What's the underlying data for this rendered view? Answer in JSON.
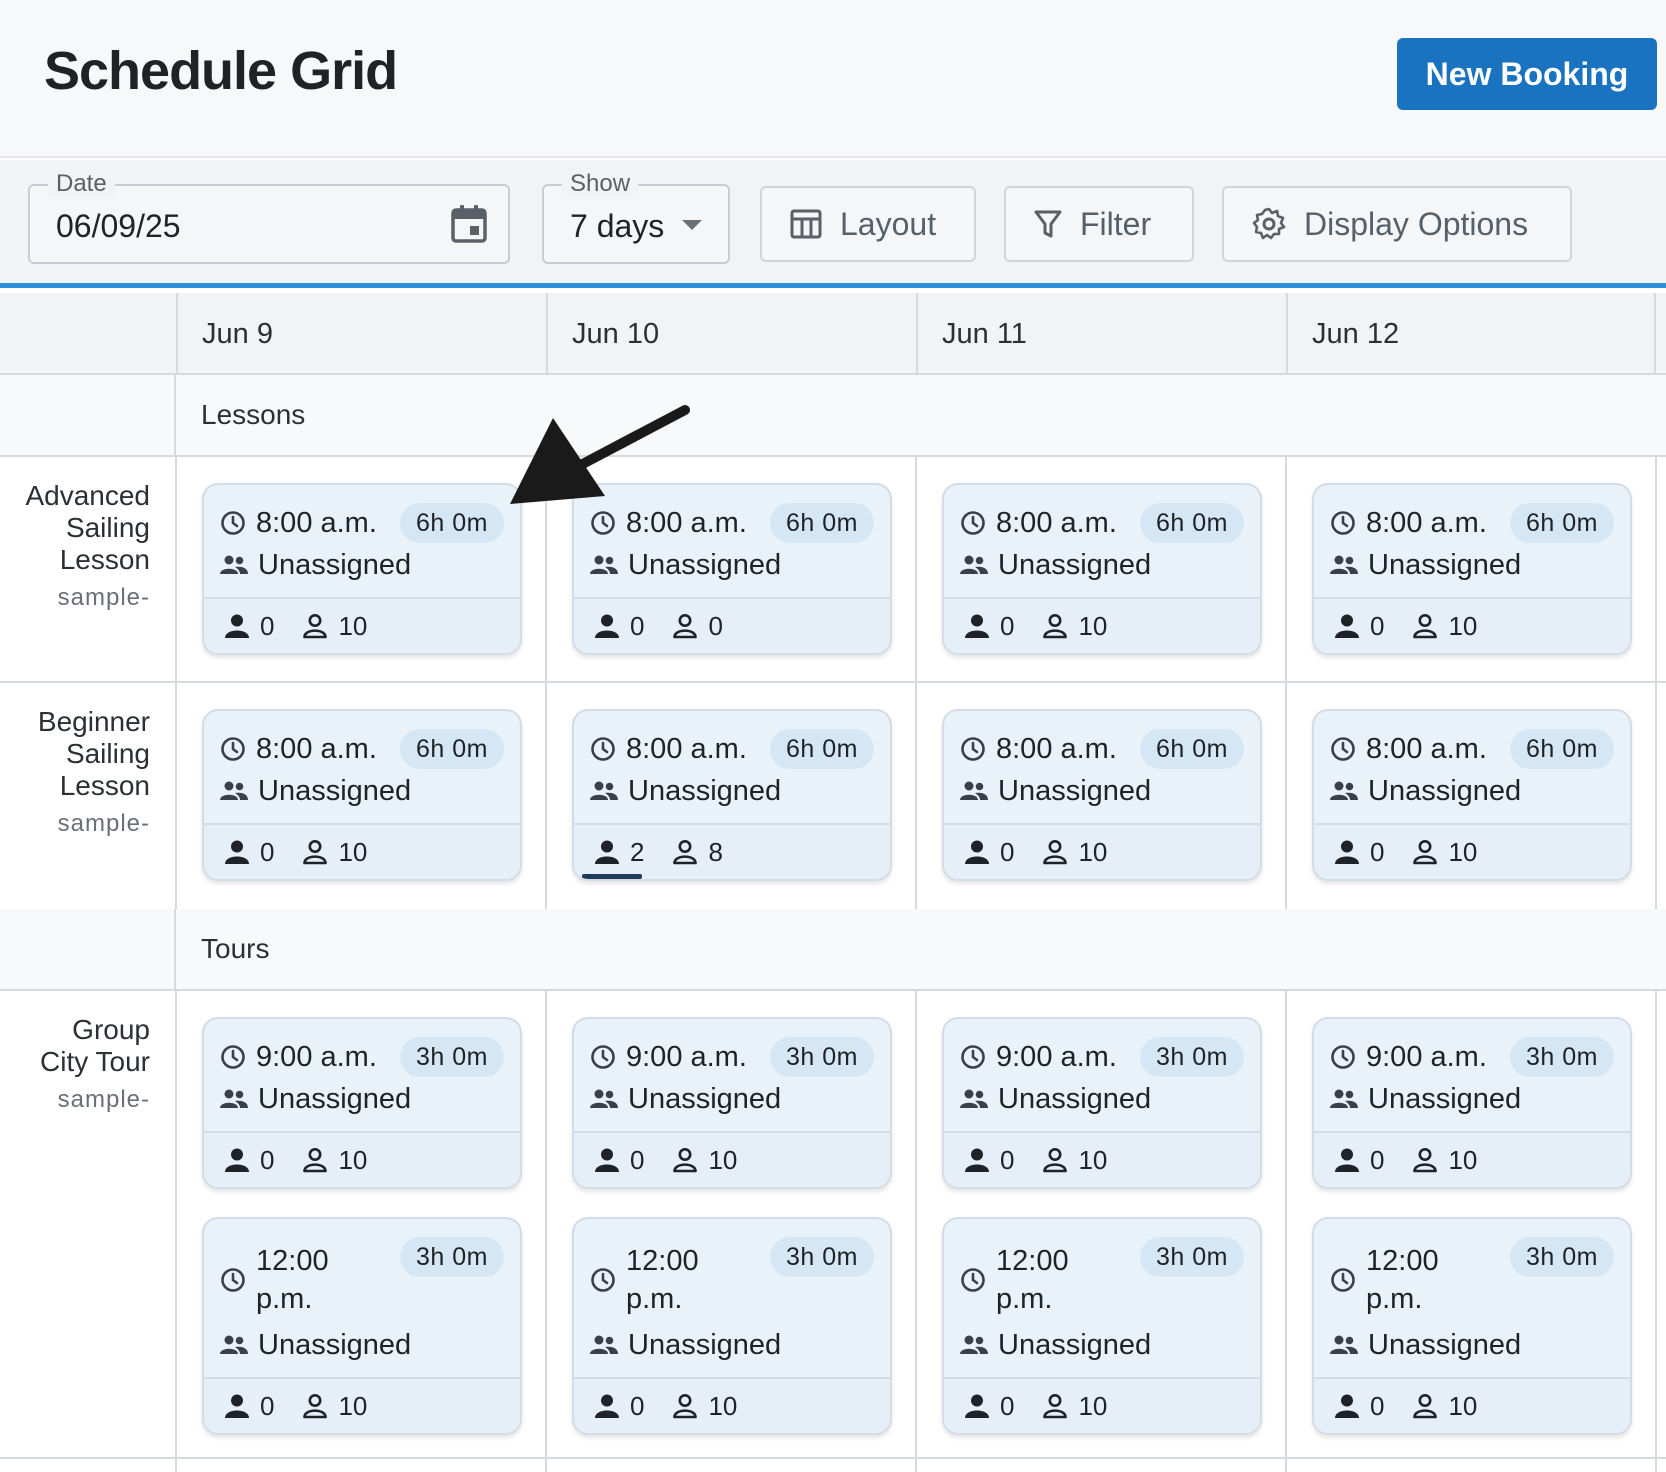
{
  "header": {
    "title": "Schedule Grid",
    "new_booking_label": "New Booking"
  },
  "toolbar": {
    "date": {
      "label": "Date",
      "value": "06/09/25"
    },
    "show": {
      "label": "Show",
      "value": "7 days"
    },
    "layout_label": "Layout",
    "filter_label": "Filter",
    "display_options_label": "Display Options"
  },
  "grid": {
    "dates": [
      "Jun 9",
      "Jun 10",
      "Jun 11",
      "Jun 12"
    ],
    "sections": [
      {
        "label": "Lessons"
      },
      {
        "label": "Tours"
      }
    ],
    "rows": [
      {
        "name_line1": "Advanced",
        "name_line2": "Sailing",
        "name_line3": "Lesson",
        "sub": "sample-"
      },
      {
        "name_line1": "Beginner",
        "name_line2": "Sailing",
        "name_line3": "Lesson",
        "sub": "sample-"
      },
      {
        "name_line1": "Group",
        "name_line2": "City Tour",
        "name_line3": "",
        "sub": "sample-"
      }
    ],
    "cards": {
      "adv": [
        {
          "time": "8:00 a.m.",
          "duration": "6h 0m",
          "staff": "Unassigned",
          "booked": "0",
          "available": "10"
        },
        {
          "time": "8:00 a.m.",
          "duration": "6h 0m",
          "staff": "Unassigned",
          "booked": "0",
          "available": "0"
        },
        {
          "time": "8:00 a.m.",
          "duration": "6h 0m",
          "staff": "Unassigned",
          "booked": "0",
          "available": "10"
        },
        {
          "time": "8:00 a.m.",
          "duration": "6h 0m",
          "staff": "Unassigned",
          "booked": "0",
          "available": "10"
        }
      ],
      "beg": [
        {
          "time": "8:00 a.m.",
          "duration": "6h 0m",
          "staff": "Unassigned",
          "booked": "0",
          "available": "10"
        },
        {
          "time": "8:00 a.m.",
          "duration": "6h 0m",
          "staff": "Unassigned",
          "booked": "2",
          "available": "8",
          "fill": 0.2
        },
        {
          "time": "8:00 a.m.",
          "duration": "6h 0m",
          "staff": "Unassigned",
          "booked": "0",
          "available": "10"
        },
        {
          "time": "8:00 a.m.",
          "duration": "6h 0m",
          "staff": "Unassigned",
          "booked": "0",
          "available": "10"
        }
      ],
      "tour_am": [
        {
          "time": "9:00 a.m.",
          "duration": "3h 0m",
          "staff": "Unassigned",
          "booked": "0",
          "available": "10"
        },
        {
          "time": "9:00 a.m.",
          "duration": "3h 0m",
          "staff": "Unassigned",
          "booked": "0",
          "available": "10"
        },
        {
          "time": "9:00 a.m.",
          "duration": "3h 0m",
          "staff": "Unassigned",
          "booked": "0",
          "available": "10"
        },
        {
          "time": "9:00 a.m.",
          "duration": "3h 0m",
          "staff": "Unassigned",
          "booked": "0",
          "available": "10"
        }
      ],
      "tour_pm": [
        {
          "time": "12:00 p.m.",
          "duration": "3h 0m",
          "staff": "Unassigned",
          "booked": "0",
          "available": "10"
        },
        {
          "time": "12:00 p.m.",
          "duration": "3h 0m",
          "staff": "Unassigned",
          "booked": "0",
          "available": "10"
        },
        {
          "time": "12:00 p.m.",
          "duration": "3h 0m",
          "staff": "Unassigned",
          "booked": "0",
          "available": "10"
        },
        {
          "time": "12:00 p.m.",
          "duration": "3h 0m",
          "staff": "Unassigned",
          "booked": "0",
          "available": "10"
        }
      ]
    }
  },
  "icons": {
    "calendar": "calendar-icon",
    "caret": "caret-down-icon",
    "layout": "table-layout-icon",
    "filter": "filter-icon",
    "gear": "gear-icon",
    "clock": "clock-icon",
    "group": "group-icon",
    "person_filled": "person-filled-icon",
    "person_outline": "person-outline-icon",
    "arrow": "annotation-arrow-icon"
  },
  "colors": {
    "accent": "#1a73c0",
    "toolbar_border": "#2d8fd7",
    "card_bg": "#e9f1f9",
    "badge_bg": "#d5e6f5",
    "fill_bar": "#1f3b5a"
  }
}
